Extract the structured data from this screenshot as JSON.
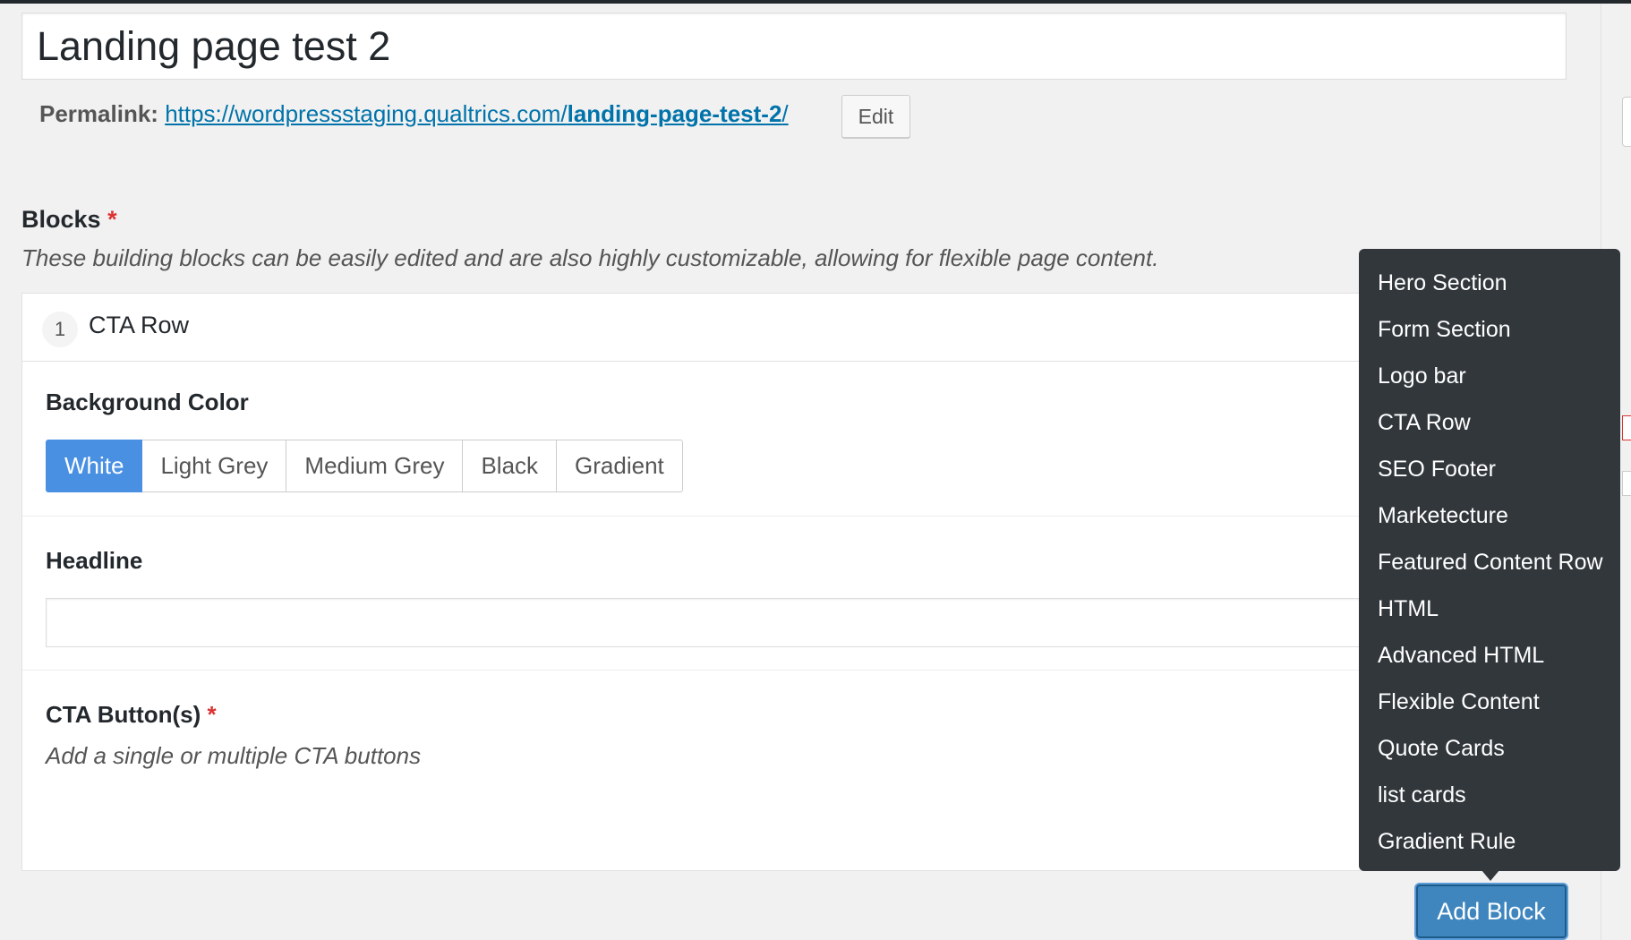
{
  "post": {
    "title": "Landing page test 2",
    "permalink_label": "Permalink:",
    "permalink_base": "https://wordpressstaging.qualtrics.com/",
    "permalink_slug": "landing-page-test-2",
    "permalink_trailing": "/",
    "edit_label": "Edit"
  },
  "blocks": {
    "label": "Blocks",
    "required_mark": "*",
    "description": "These building blocks can be easily edited and are also highly customizable, allowing for flexible page content.",
    "row": {
      "order": "1",
      "title": "CTA Row",
      "background_color": {
        "label": "Background Color",
        "options": [
          "White",
          "Light Grey",
          "Medium Grey",
          "Black",
          "Gradient"
        ],
        "selected": "White"
      },
      "headline": {
        "label": "Headline",
        "value": ""
      },
      "cta_buttons": {
        "label": "CTA Button(s)",
        "required_mark": "*",
        "description": "Add a single or multiple CTA buttons"
      }
    }
  },
  "add_block_menu": {
    "items": [
      "Hero Section",
      "Form Section",
      "Logo bar",
      "CTA Row",
      "SEO Footer",
      "Marketecture",
      "Featured Content Row",
      "HTML",
      "Advanced HTML",
      "Flexible Content",
      "Quote Cards",
      "list cards",
      "Gradient Rule"
    ]
  },
  "add_block_label": "Add Block",
  "colors": {
    "accent": "#4a90e2",
    "menu_bg": "#32373c",
    "link": "#0073aa",
    "required": "#dc3232"
  }
}
